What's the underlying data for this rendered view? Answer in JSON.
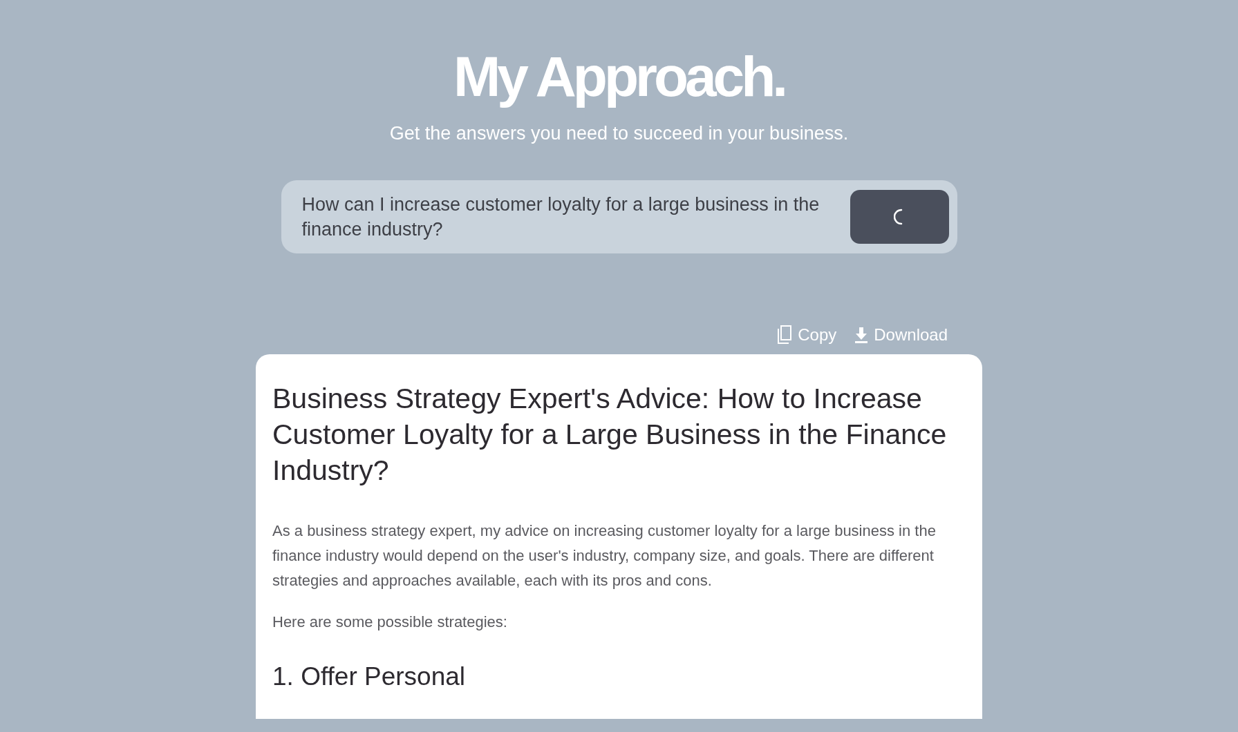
{
  "header": {
    "title": "My Approach.",
    "subtitle": "Get the answers you need to succeed in your business."
  },
  "question": {
    "value": "How can I increase customer loyalty for a large business in the finance industry?"
  },
  "actions": [
    {
      "kind": "copy",
      "label": "Copy"
    },
    {
      "kind": "download",
      "label": "Download"
    }
  ],
  "answer": {
    "title": "Business Strategy Expert's Advice: How to Increase Customer Loyalty for a Large Business in the Finance Industry?",
    "paragraphs": [
      "As a business strategy expert, my advice on increasing customer loyalty for a large business in the finance industry would depend on the user's industry, company size, and goals. There are different strategies and approaches available, each with its pros and cons.",
      "Here are some possible strategies:"
    ],
    "section_heading": "1. Offer Personal"
  }
}
